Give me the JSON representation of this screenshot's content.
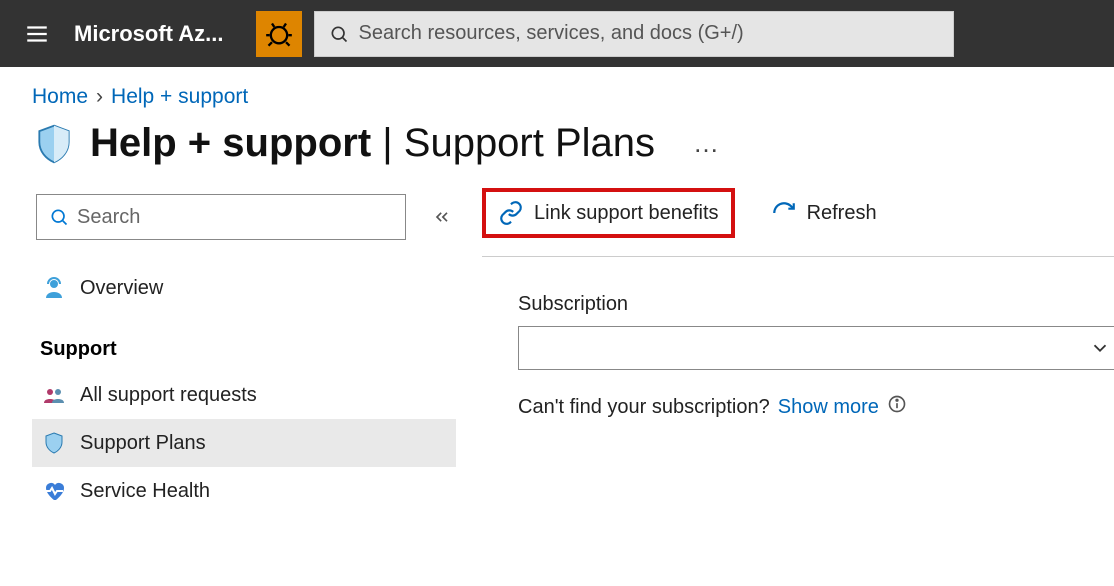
{
  "topbar": {
    "brand": "Microsoft Az...",
    "search_placeholder": "Search resources, services, and docs (G+/)"
  },
  "breadcrumb": {
    "home": "Home",
    "current": "Help + support"
  },
  "title": {
    "main": "Help + support",
    "divider": " | ",
    "sub": "Support Plans",
    "more": "…"
  },
  "sidebar": {
    "search_placeholder": "Search",
    "overview": "Overview",
    "group": "Support",
    "items": {
      "all": "All support requests",
      "plans": "Support Plans",
      "health": "Service Health"
    }
  },
  "commands": {
    "link": "Link support benefits",
    "refresh": "Refresh"
  },
  "form": {
    "subscription_label": "Subscription",
    "hint_text": "Can't find your subscription? ",
    "hint_link": "Show more"
  }
}
